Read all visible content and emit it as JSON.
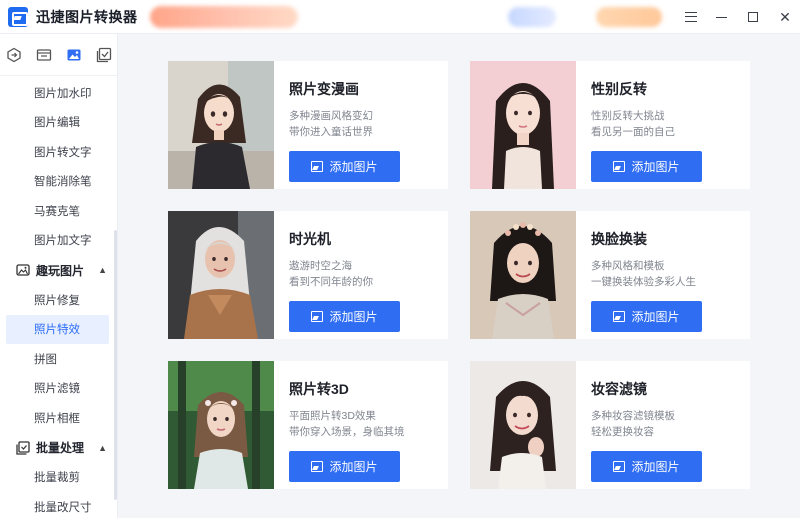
{
  "app": {
    "title": "迅捷图片转换器"
  },
  "sidebar": {
    "items_top": [
      {
        "label": "图片加水印"
      },
      {
        "label": "图片编辑"
      },
      {
        "label": "图片转文字"
      },
      {
        "label": "智能消除笔"
      },
      {
        "label": "马赛克笔"
      },
      {
        "label": "图片加文字"
      }
    ],
    "group_fun": {
      "label": "趣玩图片"
    },
    "items_fun": [
      {
        "label": "照片修复",
        "active": false
      },
      {
        "label": "照片特效",
        "active": true
      },
      {
        "label": "拼图",
        "active": false
      },
      {
        "label": "照片滤镜",
        "active": false
      },
      {
        "label": "照片相框",
        "active": false
      }
    ],
    "group_batch": {
      "label": "批量处理"
    },
    "items_batch": [
      {
        "label": "批量裁剪"
      },
      {
        "label": "批量改尺寸"
      }
    ]
  },
  "cards": [
    {
      "title": "照片变漫画",
      "desc1": "多种漫画风格变幻",
      "desc2": "带你进入童话世界",
      "button": "添加图片"
    },
    {
      "title": "性别反转",
      "desc1": "性别反转大挑战",
      "desc2": "看见另一面的自己",
      "button": "添加图片"
    },
    {
      "title": "时光机",
      "desc1": "遨游时空之海",
      "desc2": "看到不同年龄的你",
      "button": "添加图片"
    },
    {
      "title": "换脸换装",
      "desc1": "多种风格和模板",
      "desc2": "一键换装体验多彩人生",
      "button": "添加图片"
    },
    {
      "title": "照片转3D",
      "desc1": "平面照片转3D效果",
      "desc2": "带你穿入场景，身临其境",
      "button": "添加图片"
    },
    {
      "title": "妆容滤镜",
      "desc1": "多种妆容滤镜模板",
      "desc2": "轻松更换妆容",
      "button": "添加图片"
    }
  ],
  "colors": {
    "accent": "#2f6df3",
    "active_bg": "#e8efff"
  }
}
